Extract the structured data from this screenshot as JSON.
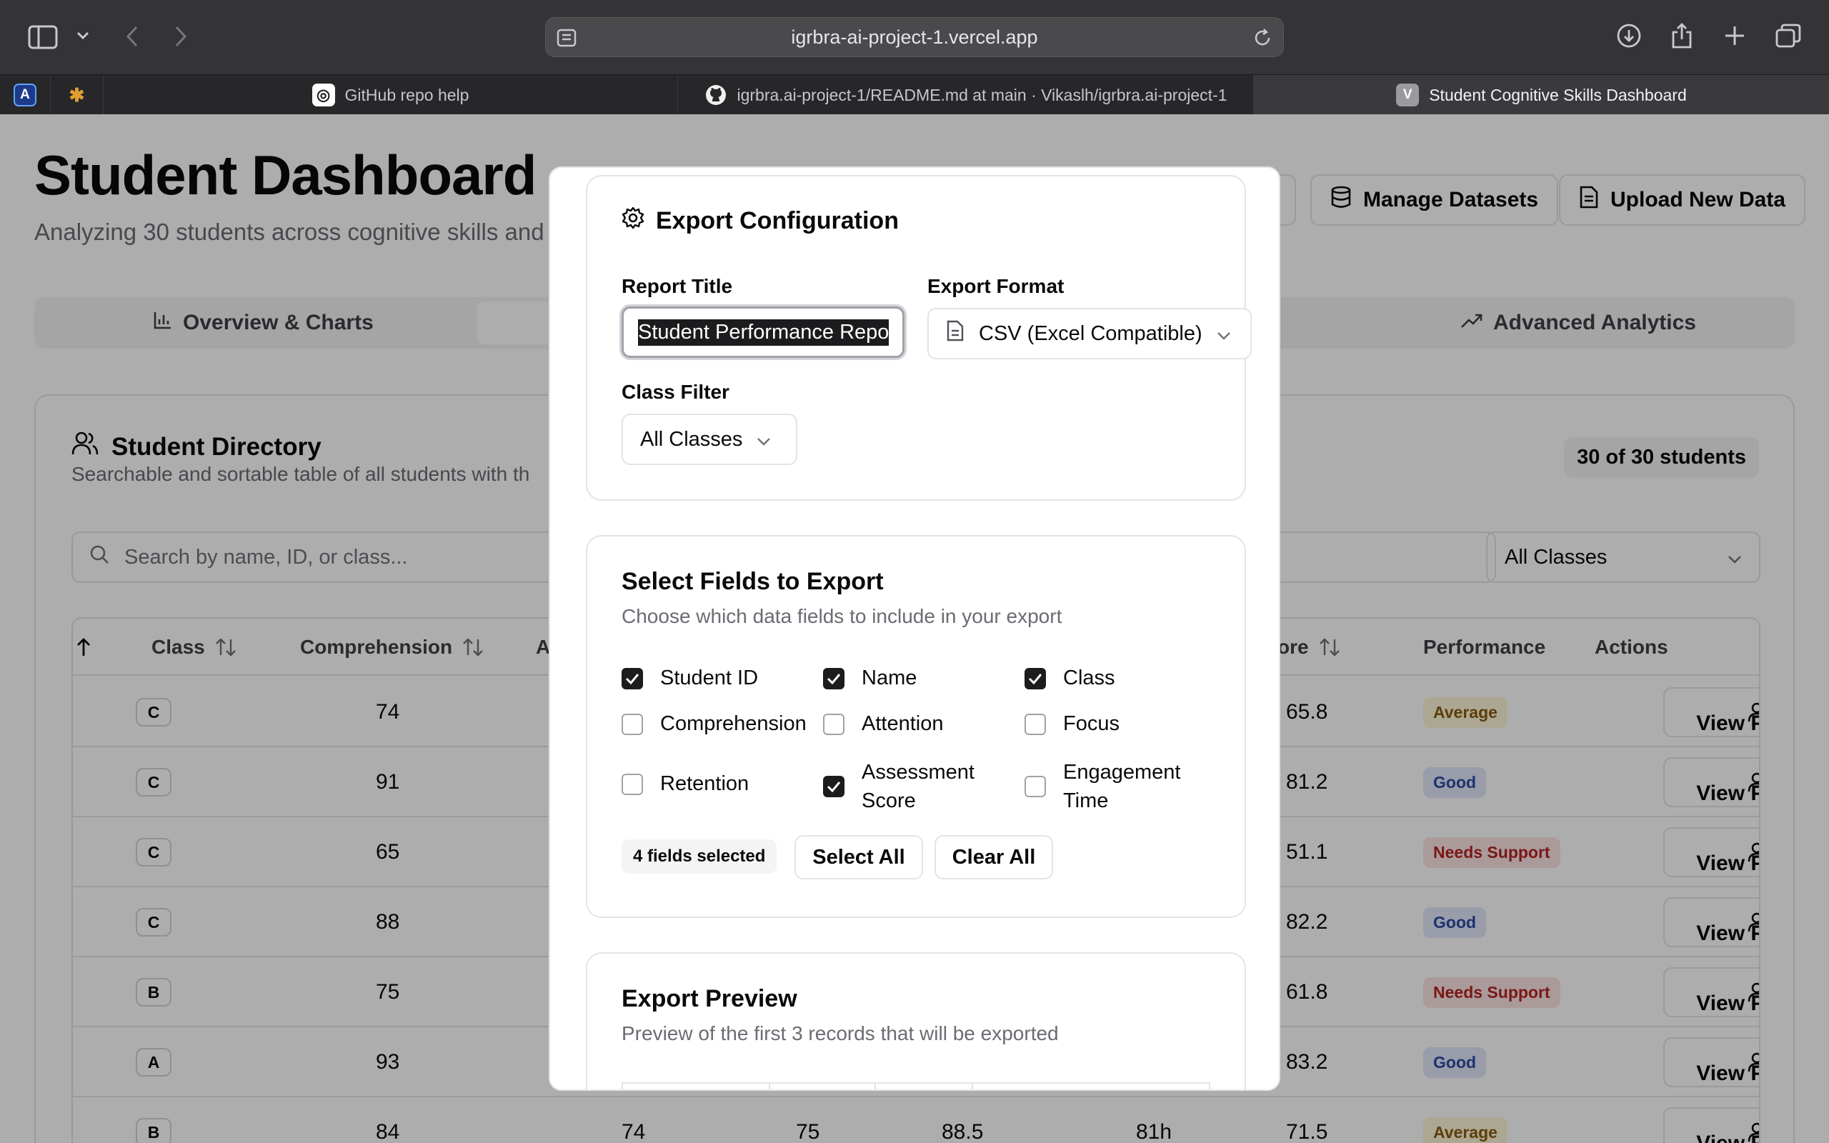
{
  "browser": {
    "url": "igrbra-ai-project-1.vercel.app",
    "tabs": [
      {
        "label": "",
        "icon": "app-a-icon"
      },
      {
        "label": "",
        "icon": "claude-icon"
      },
      {
        "label": "GitHub repo help",
        "icon": "chatgpt-icon"
      },
      {
        "label": "igrbra.ai-project-1/README.md at main · Vikaslh/igrbra.ai-project-1",
        "icon": "github-icon"
      },
      {
        "label": "Student Cognitive Skills Dashboard",
        "icon": "v-favicon",
        "favicon_letter": "V"
      }
    ]
  },
  "header": {
    "title": "Student Dashboard",
    "subtitle": "Analyzing 30 students across cognitive skills and",
    "buttons": {
      "manage": "Manage Datasets",
      "upload": "Upload New Data"
    }
  },
  "nav_tabs": {
    "overview": "Overview & Charts",
    "advanced": "Advanced Analytics"
  },
  "directory": {
    "title": "Student Directory",
    "subtitle": "Searchable and sortable table of all students with th",
    "count": "30 of 30 students",
    "search_placeholder": "Search by name, ID, or class...",
    "class_filter": "All Classes",
    "columns": {
      "class": "Class",
      "comprehension": "Comprehension",
      "a": "A",
      "score": "ore",
      "performance": "Performance",
      "actions": "Actions"
    },
    "view_profile_label": "View Profile",
    "rows": [
      {
        "class": "C",
        "comprehension": "74",
        "score": "65.8",
        "performance": "Average"
      },
      {
        "class": "C",
        "comprehension": "91",
        "score": "81.2",
        "performance": "Good"
      },
      {
        "class": "C",
        "comprehension": "65",
        "score": "51.1",
        "performance": "Needs Support"
      },
      {
        "class": "C",
        "comprehension": "88",
        "score": "82.2",
        "performance": "Good"
      },
      {
        "class": "B",
        "comprehension": "75",
        "score": "61.8",
        "performance": "Needs Support"
      },
      {
        "class": "A",
        "comprehension": "93",
        "score": "83.2",
        "performance": "Good"
      },
      {
        "class": "B",
        "comprehension": "84",
        "attention": "74",
        "focus": "75",
        "retention": "88.5",
        "engagement": "81h",
        "score": "71.5",
        "performance": "Average"
      }
    ]
  },
  "modal": {
    "config": {
      "title": "Export Configuration",
      "report_title_label": "Report Title",
      "report_title_value": "Student Performance Repo",
      "export_format_label": "Export Format",
      "export_format_value": "CSV (Excel Compatible)",
      "class_filter_label": "Class Filter",
      "class_filter_value": "All Classes"
    },
    "fields": {
      "title": "Select Fields to Export",
      "description": "Choose which data fields to include in your export",
      "items": [
        {
          "label": "Student ID",
          "checked": true
        },
        {
          "label": "Name",
          "checked": true
        },
        {
          "label": "Class",
          "checked": true
        },
        {
          "label": "Comprehension",
          "checked": false
        },
        {
          "label": "Attention",
          "checked": false
        },
        {
          "label": "Focus",
          "checked": false
        },
        {
          "label": "Retention",
          "checked": false
        },
        {
          "label_line1": "Assessment",
          "label_line2": "Score",
          "checked": true
        },
        {
          "label_line1": "Engagement",
          "label_line2": "Time",
          "checked": false
        }
      ],
      "selected_count": "4 fields selected",
      "select_all": "Select All",
      "clear_all": "Clear All"
    },
    "preview": {
      "title": "Export Preview",
      "description": "Preview of the first 3 records that will be exported"
    }
  },
  "colors": {
    "overlay": "#000000",
    "average": "#8a5a10",
    "good": "#2d4aa6",
    "needs_support": "#b42323"
  }
}
